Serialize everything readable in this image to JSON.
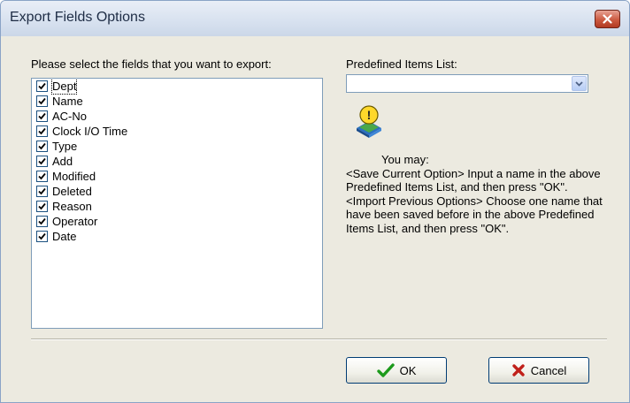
{
  "window": {
    "title": "Export Fields Options",
    "close_icon": "close-icon"
  },
  "fields": {
    "label": "Please select the fields that you want to export:",
    "items": [
      {
        "label": "Dept",
        "checked": true
      },
      {
        "label": "Name",
        "checked": true
      },
      {
        "label": "AC-No",
        "checked": true
      },
      {
        "label": "Clock I/O Time",
        "checked": true
      },
      {
        "label": "Type",
        "checked": true
      },
      {
        "label": "Add",
        "checked": true
      },
      {
        "label": "Modified",
        "checked": true
      },
      {
        "label": "Deleted",
        "checked": true
      },
      {
        "label": "Reason",
        "checked": true
      },
      {
        "label": "Operator",
        "checked": true
      },
      {
        "label": "Date",
        "checked": true
      }
    ]
  },
  "predefined": {
    "label": "Predefined Items List:",
    "value": "",
    "dropdown_icon": "chevron-down-icon"
  },
  "info": {
    "icon": "info-tip-icon",
    "line1": "You may:",
    "line2": "<Save Current Option> Input a name in the above Predefined Items List, and then press \"OK\".",
    "line3": "<Import Previous Options> Choose one name that have been saved before in the above Predefined Items List, and then press \"OK\"."
  },
  "buttons": {
    "ok_label": "OK",
    "ok_icon": "check-icon",
    "cancel_label": "Cancel",
    "cancel_icon": "x-icon"
  },
  "colors": {
    "titlebar": "#d7e1ef",
    "close": "#cc5a41",
    "dialog_bg": "#eceae0",
    "check": "#1c9a1c",
    "cancel_x": "#c0201a"
  }
}
